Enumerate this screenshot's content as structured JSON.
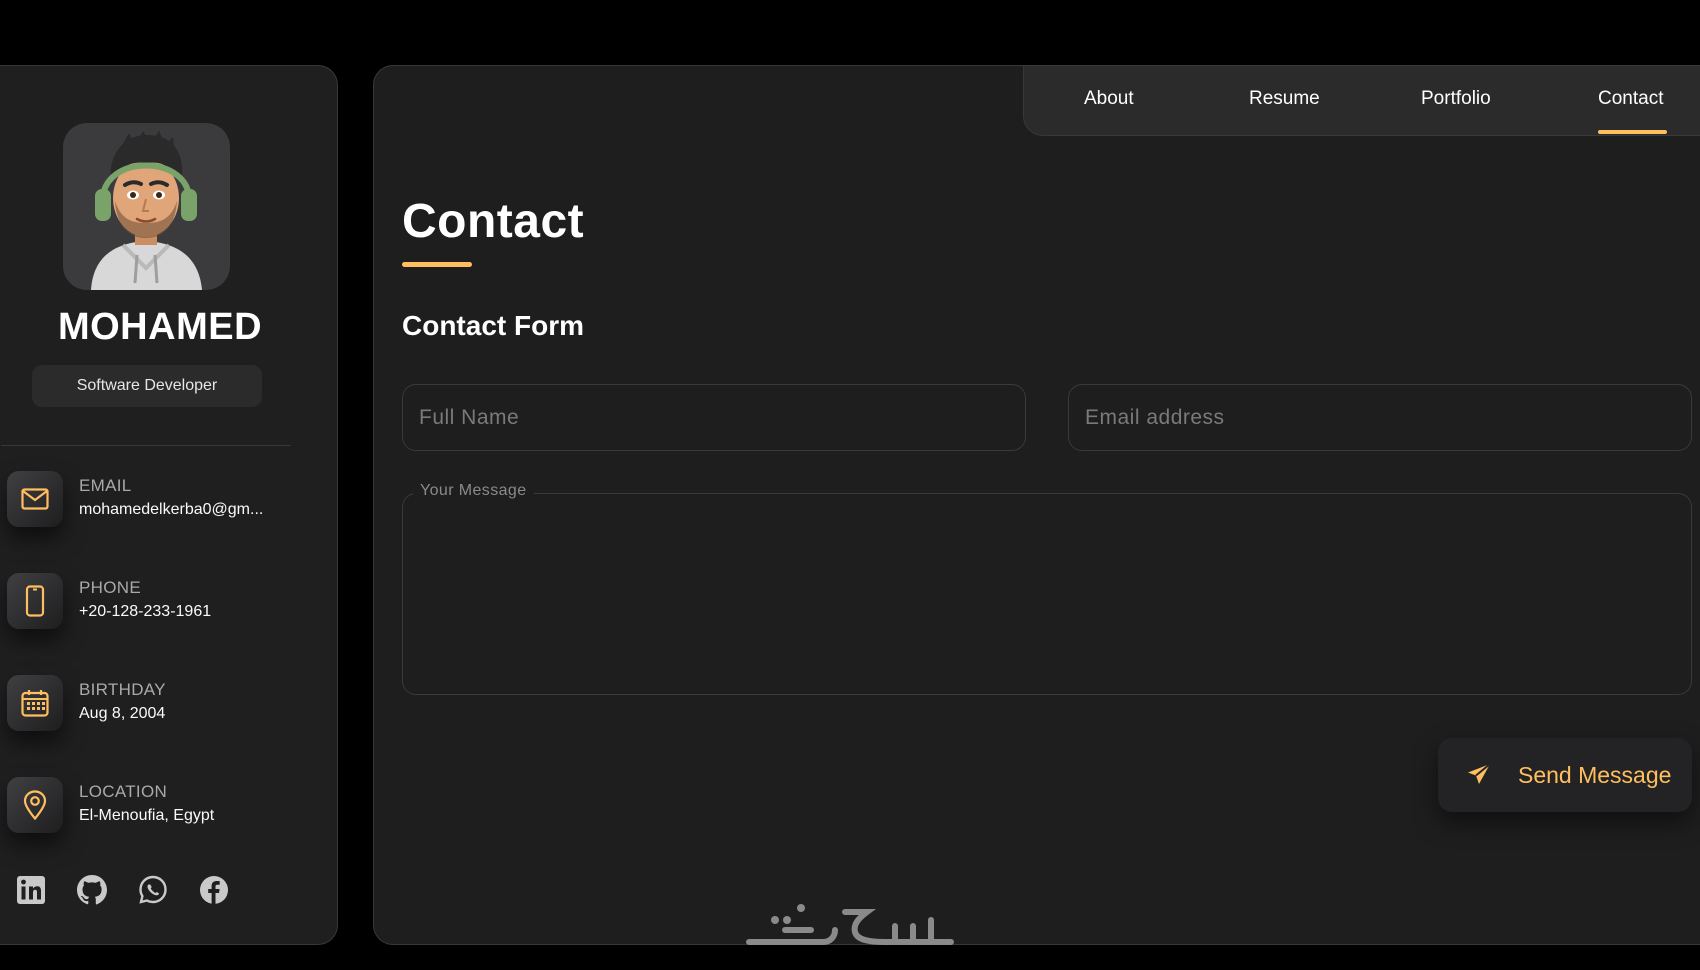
{
  "sidebar": {
    "name": "MOHAMED",
    "role": "Software Developer",
    "contacts": [
      {
        "label": "EMAIL",
        "value": "mohamedelkerba0@gm...",
        "icon": "mail-icon"
      },
      {
        "label": "PHONE",
        "value": "+20-128-233-1961",
        "icon": "phone-icon"
      },
      {
        "label": "BIRTHDAY",
        "value": "Aug 8, 2004",
        "icon": "calendar-icon"
      },
      {
        "label": "LOCATION",
        "value": "El-Menoufia, Egypt",
        "icon": "location-icon"
      }
    ],
    "socials": [
      "linkedin-icon",
      "github-icon",
      "whatsapp-icon",
      "facebook-icon"
    ]
  },
  "nav": {
    "items": [
      "About",
      "Resume",
      "Portfolio",
      "Contact"
    ],
    "active": "Contact"
  },
  "main": {
    "title": "Contact",
    "form_title": "Contact Form",
    "fullname_placeholder": "Full Name",
    "email_placeholder": "Email address",
    "message_label": "Your Message",
    "send_label": "Send Message"
  },
  "watermark": "خمسات",
  "colors": {
    "accent": "#ffbf5f",
    "panel": "#1e1e1f",
    "background": "#000000"
  }
}
